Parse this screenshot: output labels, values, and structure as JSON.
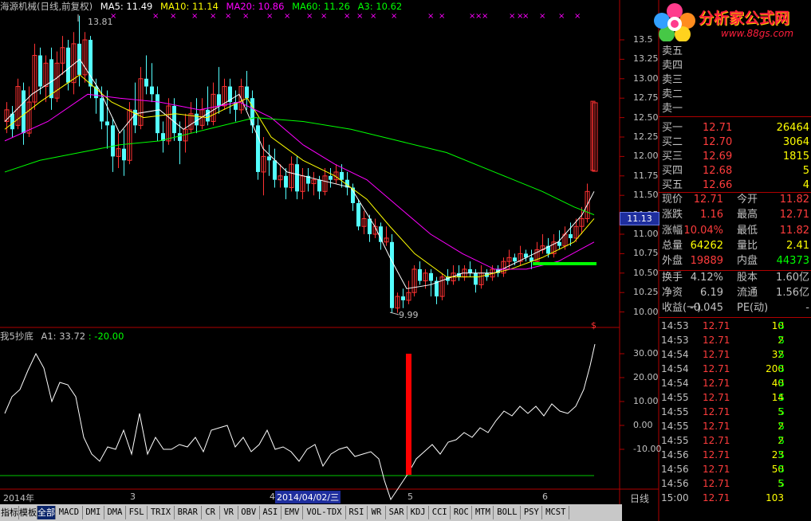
{
  "header": {
    "stock": "海源机械(日线,前复权)",
    "ma5": "MA5: 11.49",
    "ma10": "MA10: 11.14",
    "ma20": "MA20: 10.86",
    "ma60": "MA60: 11.26",
    "a3": "A3: 10.62"
  },
  "indicator_header": {
    "name": "我5抄底",
    "a1": "A1: 33.72",
    "level": ": -20.00"
  },
  "price_axis": [
    "13.5",
    "13.25",
    "13.00",
    "12.75",
    "12.50",
    "12.25",
    "12.00",
    "11.75",
    "11.50",
    "11.25",
    "11.00",
    "10.75",
    "10.50",
    "10.25",
    "10.00"
  ],
  "indicator_axis": [
    "30.00",
    "20.00",
    "10.00",
    "0.00",
    "-10.00"
  ],
  "current_price_badge": "11.13",
  "high_label": "13.81",
  "low_label": "9.99",
  "x_axis": {
    "year": "2014年",
    "m3": "3",
    "m4": "4",
    "cursor_date": "2014/04/02/三",
    "m5": "5",
    "m6": "6",
    "period": "日线"
  },
  "logo": {
    "title": "分析家公式网",
    "url": "www.88gs.com"
  },
  "order_book": [
    {
      "label": "卖五",
      "price": "",
      "vol": ""
    },
    {
      "label": "卖四",
      "price": "",
      "vol": ""
    },
    {
      "label": "卖三",
      "price": "",
      "vol": ""
    },
    {
      "label": "卖二",
      "price": "",
      "vol": ""
    },
    {
      "label": "卖一",
      "price": "",
      "vol": ""
    },
    {
      "label": "买一",
      "price": "12.71",
      "vol": "26464"
    },
    {
      "label": "买二",
      "price": "12.70",
      "vol": "3064"
    },
    {
      "label": "买三",
      "price": "12.69",
      "vol": "1815"
    },
    {
      "label": "买四",
      "price": "12.68",
      "vol": "5"
    },
    {
      "label": "买五",
      "price": "12.66",
      "vol": "4"
    }
  ],
  "quote": [
    {
      "l1": "现价",
      "v1": "12.71",
      "l2": "今开",
      "v2": "11.82"
    },
    {
      "l1": "涨跌",
      "v1": "1.16",
      "l2": "最高",
      "v2": "12.71"
    },
    {
      "l1": "涨幅",
      "v1": "10.04%",
      "l2": "最低",
      "v2": "11.82"
    },
    {
      "l1": "总量",
      "v1": "64262",
      "l2": "量比",
      "v2": "2.41"
    },
    {
      "l1": "外盘",
      "v1": "19889",
      "l2": "内盘",
      "v2": "44373"
    }
  ],
  "stats": [
    {
      "l1": "换手",
      "v1": "4.12%",
      "l2": "股本",
      "v2": "1.60亿"
    },
    {
      "l1": "净资",
      "v1": "6.19",
      "l2": "流通",
      "v2": "1.56亿"
    },
    {
      "l1": "收益(一)",
      "v1": "-0.045",
      "l2": "PE(动)",
      "v2": "-"
    }
  ],
  "ticks": [
    {
      "t": "14:53",
      "p": "12.71",
      "v": "10",
      "s": "S"
    },
    {
      "t": "14:53",
      "p": "12.71",
      "v": "2",
      "s": "S"
    },
    {
      "t": "14:54",
      "p": "12.71",
      "v": "32",
      "s": "S"
    },
    {
      "t": "14:54",
      "p": "12.71",
      "v": "200",
      "s": "S"
    },
    {
      "t": "14:54",
      "p": "12.71",
      "v": "40",
      "s": "S"
    },
    {
      "t": "14:55",
      "p": "12.71",
      "v": "14",
      "s": "S"
    },
    {
      "t": "14:55",
      "p": "12.71",
      "v": "5",
      "s": "S"
    },
    {
      "t": "14:55",
      "p": "12.71",
      "v": "2",
      "s": "S"
    },
    {
      "t": "14:55",
      "p": "12.71",
      "v": "2",
      "s": "S"
    },
    {
      "t": "14:56",
      "p": "12.71",
      "v": "23",
      "s": "S"
    },
    {
      "t": "14:56",
      "p": "12.71",
      "v": "50",
      "s": "S"
    },
    {
      "t": "14:56",
      "p": "12.71",
      "v": "5",
      "s": "S"
    },
    {
      "t": "15:00",
      "p": "12.71",
      "v": "103",
      "s": ""
    }
  ],
  "tabs": [
    "指标",
    "模板",
    "全部",
    "MACD",
    "DMI",
    "DMA",
    "FSL",
    "TRIX",
    "BRAR",
    "CR",
    "VR",
    "OBV",
    "ASI",
    "EMV",
    "VOL-TDX",
    "RSI",
    "WR",
    "SAR",
    "KDJ",
    "CCI",
    "ROC",
    "MTM",
    "BOLL",
    "PSY",
    "MCST"
  ],
  "colors": {
    "up_candle": "#ff3232",
    "down_candle": "#54ffff",
    "ma5": "#ffffff",
    "ma10": "#ffff00",
    "ma20": "#ff00ff",
    "ma60": "#00ff00",
    "a3": "#00ff00",
    "signal_bar": "#ff0000",
    "axis": "#b00000",
    "badge": "#1e2e9e"
  }
}
